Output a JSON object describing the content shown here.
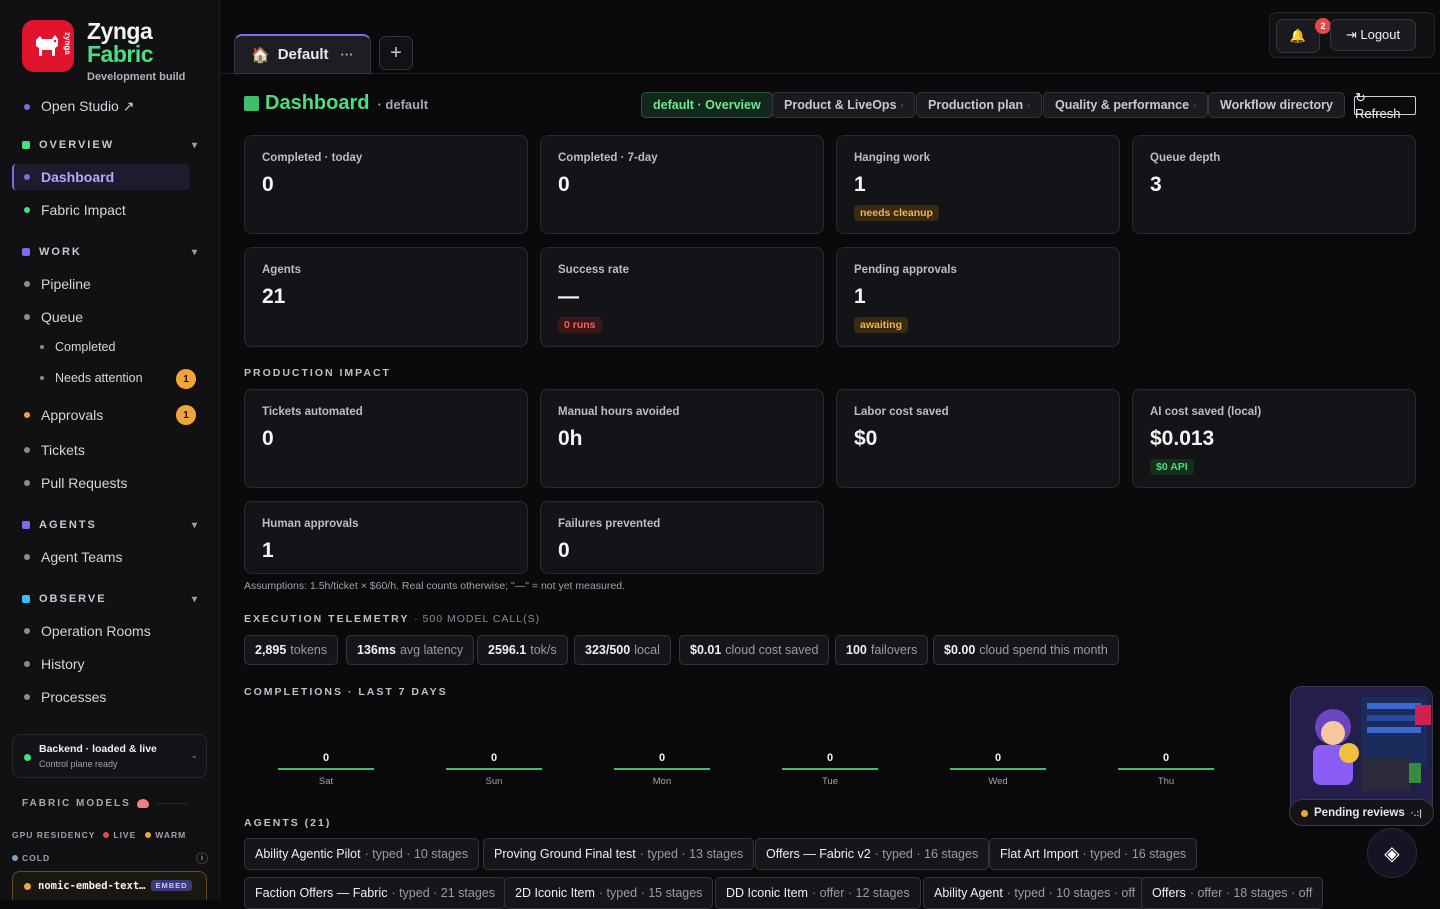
{
  "brand": {
    "name1": "Zynga",
    "name2": "Fabric",
    "subtitle": "Development build",
    "logo_text": "zynga"
  },
  "sidebar": {
    "open_studio": "Open Studio ↗",
    "sections": {
      "overview": "OVERVIEW",
      "work": "WORK",
      "agents": "AGENTS",
      "observe": "OBSERVE"
    },
    "items": {
      "dashboard": "Dashboard",
      "fabric_impact": "Fabric Impact",
      "pipeline": "Pipeline",
      "queue": "Queue",
      "completed": "Completed",
      "needs_attention": "Needs attention",
      "needs_attention_count": "1",
      "approvals": "Approvals",
      "approvals_count": "1",
      "tickets": "Tickets",
      "pull_requests": "Pull Requests",
      "agent_teams": "Agent Teams",
      "operation_rooms": "Operation Rooms",
      "history": "History",
      "processes": "Processes"
    },
    "backend": {
      "title": "Backend · loaded & live",
      "subtitle": "Control plane ready"
    },
    "fabric_models": "FABRIC MODELS",
    "gpu": {
      "label": "GPU RESIDENCY",
      "live": "LIVE",
      "warm": "WARM",
      "cold": "COLD",
      "info": "i"
    },
    "model": {
      "name": "nomic-embed-text…",
      "tag": "EMBED"
    }
  },
  "topbar": {
    "tab_label": "Default",
    "tab_menu": "···",
    "add": "+",
    "bell_count": "2",
    "logout": "⇥ Logout"
  },
  "header": {
    "title": "Dashboard",
    "scope": "· default",
    "chips": [
      "default · Overview",
      "Product & LiveOps",
      "Production plan",
      "Quality & performance",
      "Workflow directory"
    ],
    "chip_mark": "◦",
    "refresh": "↻ Refresh"
  },
  "stats": [
    {
      "label": "Completed · today",
      "value": "0"
    },
    {
      "label": "Completed · 7-day",
      "value": "0"
    },
    {
      "label": "Hanging work",
      "value": "1",
      "pill": "needs cleanup"
    },
    {
      "label": "Queue depth",
      "value": "3"
    },
    {
      "label": "Agents",
      "value": "21"
    },
    {
      "label": "Success rate",
      "value": "—",
      "pill": "0 runs"
    },
    {
      "label": "Pending approvals",
      "value": "1",
      "pill": "awaiting"
    }
  ],
  "impact": {
    "heading": "PRODUCTION IMPACT",
    "cards": [
      {
        "label": "Tickets automated",
        "value": "0"
      },
      {
        "label": "Manual hours avoided",
        "value": "0h"
      },
      {
        "label": "Labor cost saved",
        "value": "$0"
      },
      {
        "label": "AI cost saved (local)",
        "value": "$0.013",
        "pill": "$0 API"
      },
      {
        "label": "Human approvals",
        "value": "1"
      },
      {
        "label": "Failures prevented",
        "value": "0"
      }
    ],
    "assumptions": "Assumptions: 1.5h/ticket × $60/h. Real counts otherwise; \"—\" = not yet measured."
  },
  "telemetry": {
    "heading": "EXECUTION TELEMETRY",
    "sub": "· 500 MODEL CALL(S)",
    "items": [
      {
        "v": "2,895",
        "l": "tokens"
      },
      {
        "v": "136ms",
        "l": "avg latency"
      },
      {
        "v": "2596.1",
        "l": "tok/s"
      },
      {
        "v": "323/500",
        "l": "local"
      },
      {
        "v": "$0.01",
        "l": "cloud cost saved"
      },
      {
        "v": "100",
        "l": "failovers"
      },
      {
        "v": "$0.00",
        "l": "cloud spend this month"
      }
    ]
  },
  "completions": {
    "heading": "COMPLETIONS · LAST 7 DAYS",
    "days": [
      {
        "d": "Sat",
        "n": "0"
      },
      {
        "d": "Sun",
        "n": "0"
      },
      {
        "d": "Mon",
        "n": "0"
      },
      {
        "d": "Tue",
        "n": "0"
      },
      {
        "d": "Wed",
        "n": "0"
      },
      {
        "d": "Thu",
        "n": "0"
      }
    ]
  },
  "agents": {
    "heading": "AGENTS (21)",
    "items": [
      {
        "n": "Ability Agentic Pilot",
        "m": "· typed · 10 stages"
      },
      {
        "n": "Proving Ground Final test",
        "m": "· typed · 13 stages"
      },
      {
        "n": "Offers — Fabric v2",
        "m": "· typed · 16 stages"
      },
      {
        "n": "Flat Art Import",
        "m": "· typed · 16 stages"
      },
      {
        "n": "Faction Offers — Fabric",
        "m": "· typed · 21 stages"
      },
      {
        "n": "2D Iconic Item",
        "m": "· typed · 15 stages"
      },
      {
        "n": "DD Iconic Item",
        "m": "· offer · 12 stages"
      },
      {
        "n": "Ability Agent",
        "m": "· typed · 10 stages · off"
      },
      {
        "n": "Offers",
        "m": "· offer · 18 stages · off"
      }
    ]
  },
  "pending": {
    "label": "Pending reviews",
    "more": "·.:|"
  },
  "colors": {
    "accent": "#4ade80",
    "brand_red": "#e0142c",
    "purple": "#7c6cf0",
    "amber": "#f0a53a"
  }
}
